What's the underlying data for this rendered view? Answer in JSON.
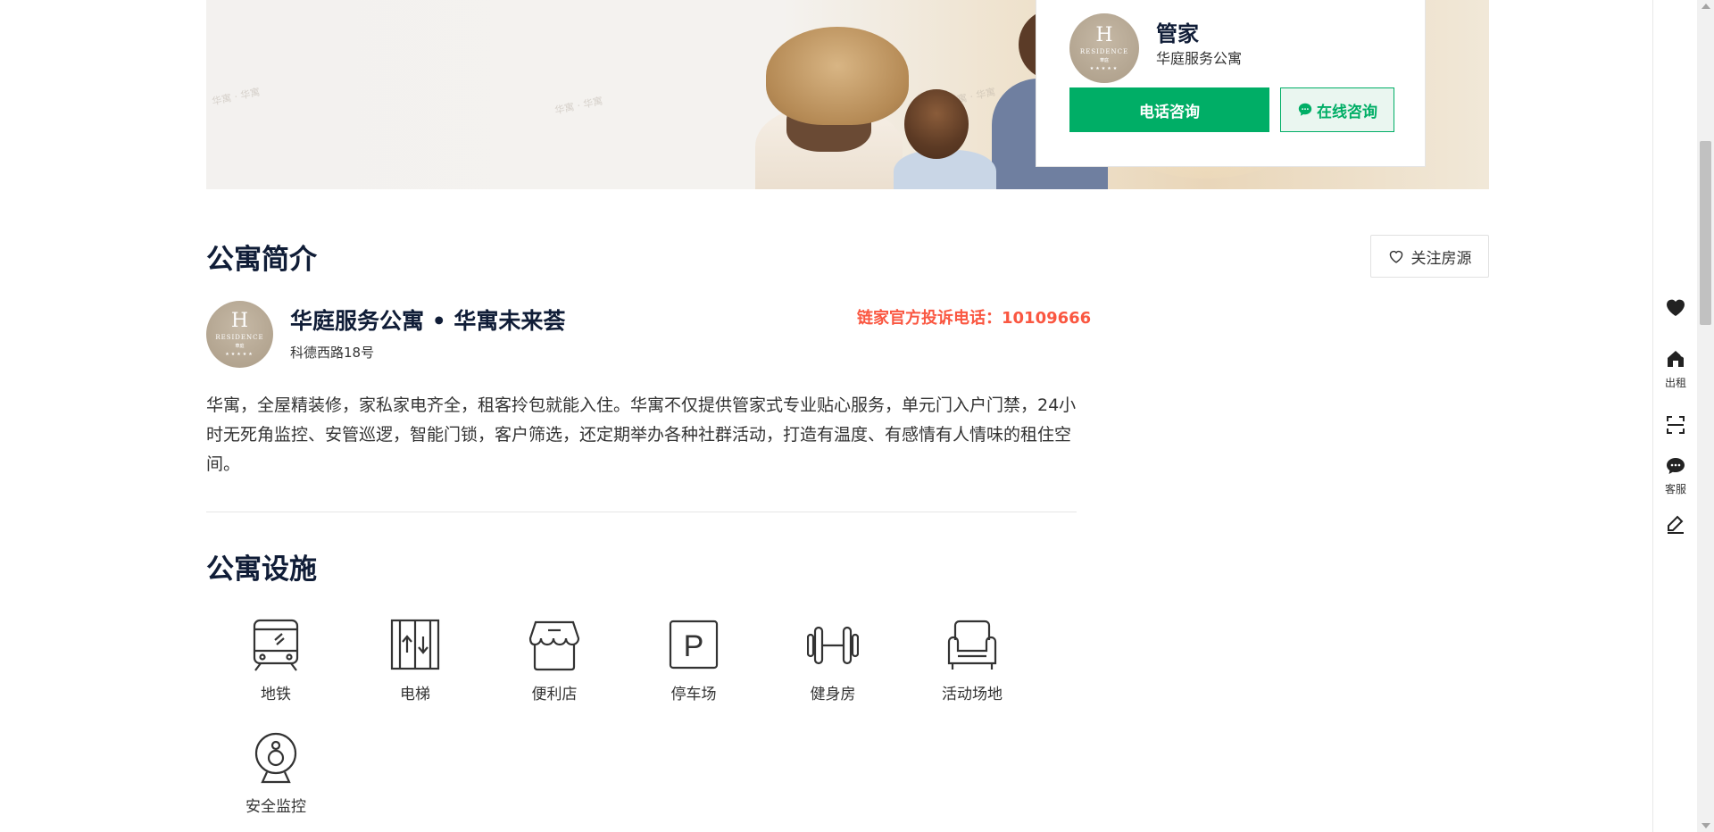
{
  "agent_card": {
    "logo": {
      "letter": "H",
      "brand": "RESIDENCE",
      "sub": "華庭",
      "stars": "★★★★★"
    },
    "name": "管家",
    "company": "华庭服务公寓",
    "phone_button": "电话咨询",
    "chat_button": "在线咨询",
    "accent_color": "#00ae66"
  },
  "intro_section": {
    "title": "公寓简介",
    "follow_button": "关注房源",
    "apartment_name": "华庭服务公寓 • 华寓未来荟",
    "address": "科德西路18号",
    "complaint_hotline": "链家官方投诉电话：10109666",
    "complaint_color": "#fa5741",
    "description": "华寓，全屋精装修，家私家电齐全，租客拎包就能入住。华寓不仅提供管家式专业贴心服务，单元门入户门禁，24小时无死角监控、安管巡逻，智能门锁，客户筛选，还定期举办各种社群活动，打造有温度、有感情有人情味的租住空间。"
  },
  "facilities_section": {
    "title": "公寓设施",
    "items": [
      {
        "label": "地铁",
        "icon": "subway-icon"
      },
      {
        "label": "电梯",
        "icon": "elevator-icon"
      },
      {
        "label": "便利店",
        "icon": "store-icon"
      },
      {
        "label": "停车场",
        "icon": "parking-icon"
      },
      {
        "label": "健身房",
        "icon": "gym-icon"
      },
      {
        "label": "活动场地",
        "icon": "sofa-icon"
      },
      {
        "label": "安全监控",
        "icon": "camera-icon"
      }
    ]
  },
  "sidebar": {
    "favorite_icon": "heart-icon",
    "rent_label": "出租",
    "scan_icon": "scan-icon",
    "service_label": "客服",
    "feedback_icon": "edit-icon"
  },
  "hero": {
    "watermark": "华寓 · 华寓"
  }
}
